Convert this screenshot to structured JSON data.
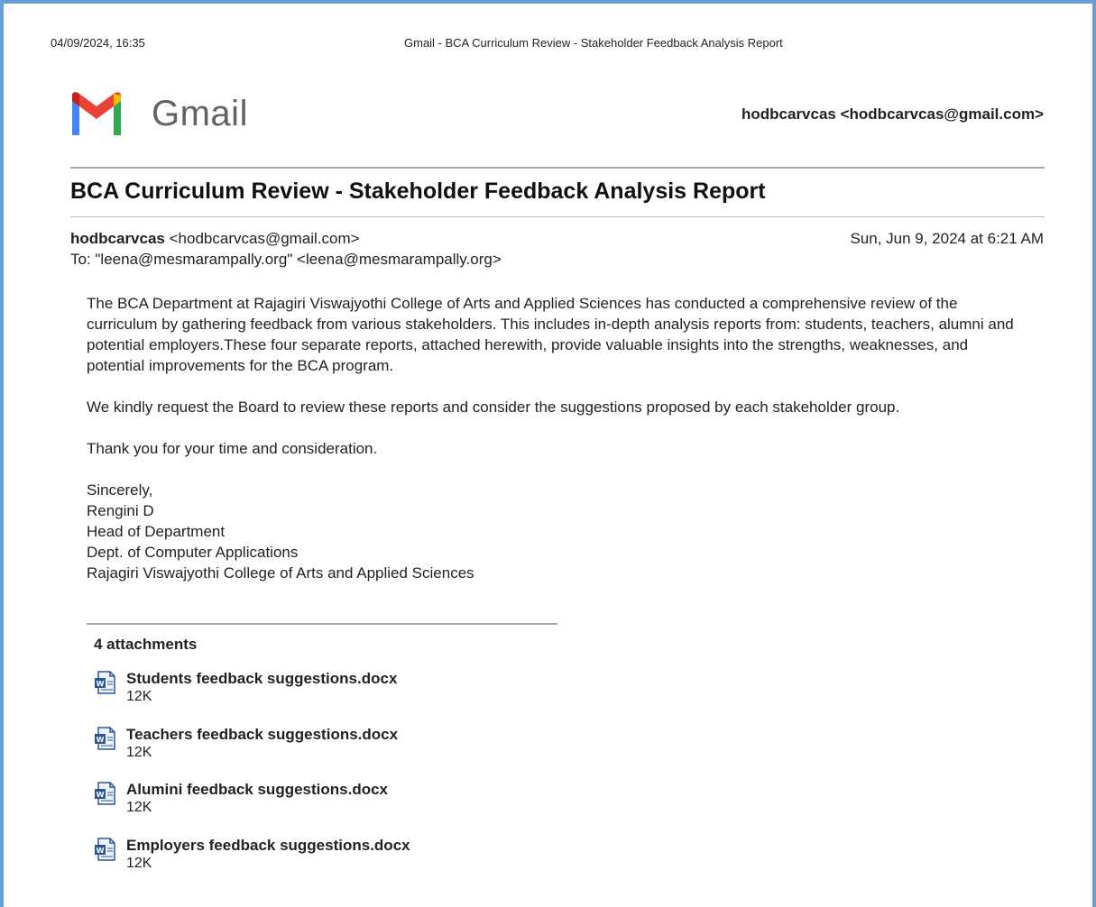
{
  "print_header": {
    "datetime": "04/09/2024, 16:35",
    "title": "Gmail - BCA Curriculum Review - Stakeholder Feedback Analysis Report"
  },
  "logo": {
    "text": "Gmail"
  },
  "account": "hodbcarvcas <hodbcarvcas@gmail.com>",
  "email": {
    "subject": "BCA Curriculum Review - Stakeholder Feedback Analysis Report",
    "sender_name": "hodbcarvcas",
    "sender_email": "<hodbcarvcas@gmail.com>",
    "to": "To: \"leena@mesmarampally.org\" <leena@mesmarampally.org>",
    "date": "Sun, Jun 9, 2024 at 6:21 AM",
    "paragraphs": [
      "The BCA Department at Rajagiri Viswajyothi College of Arts and Applied Sciences has conducted a comprehensive review of the curriculum by gathering feedback from various stakeholders. This includes in-depth analysis reports from: students, teachers, alumni and potential employers.These four separate reports, attached herewith, provide valuable insights into the strengths, weaknesses, and potential improvements for the BCA program.",
      "We kindly request the Board to review these reports and consider the suggestions proposed by each stakeholder group.",
      "Thank you for your time and consideration."
    ],
    "signature": [
      "Sincerely,",
      "Rengini D",
      "Head of Department",
      "Dept. of Computer Applications",
      "Rajagiri Viswajyothi College of Arts and Applied Sciences"
    ]
  },
  "attachments": {
    "count_label": "4 attachments",
    "items": [
      {
        "name": "Students feedback suggestions.docx",
        "size": "12K",
        "icon": "word-document-icon"
      },
      {
        "name": "Teachers feedback suggestions.docx",
        "size": "12K",
        "icon": "word-document-icon"
      },
      {
        "name": "Alumini feedback suggestions.docx",
        "size": "12K",
        "icon": "word-document-icon"
      },
      {
        "name": "Employers feedback suggestions.docx",
        "size": "12K",
        "icon": "word-document-icon"
      }
    ]
  },
  "colors": {
    "frame_border": "#6a9fd4",
    "gmail_red": "#ea4335",
    "gmail_blue": "#4285f4",
    "gmail_green": "#34a853",
    "gmail_yellow": "#fbbc04"
  }
}
